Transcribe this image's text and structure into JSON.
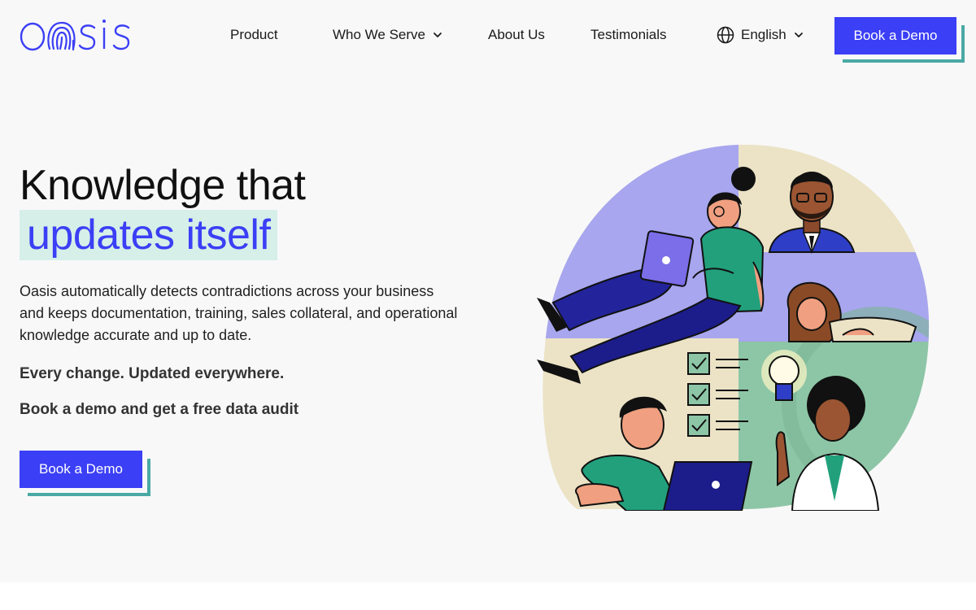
{
  "brand": {
    "logo_text": "oasis",
    "accent": "#3b3ff5",
    "shadow": "#4aa9a4",
    "highlight": "#d6efe8"
  },
  "nav": {
    "product": "Product",
    "who_we_serve": "Who We Serve",
    "about_us": "About Us",
    "testimonials": "Testimonials",
    "language": "English",
    "cta": "Book a Demo"
  },
  "hero": {
    "title_line1": "Knowledge that",
    "title_line2": "updates itself",
    "description": "Oasis automatically detects contradictions across your business and keeps documentation, training, sales collateral, and operational knowledge accurate and up to date.",
    "tagline": "Every change. Updated everywhere.",
    "offer": "Book a demo and get a free data audit",
    "cta": "Book a Demo"
  },
  "icons": {
    "chevron": "chevron-down-icon",
    "globe": "globe-icon",
    "logo": "oasis-logo-icon"
  }
}
